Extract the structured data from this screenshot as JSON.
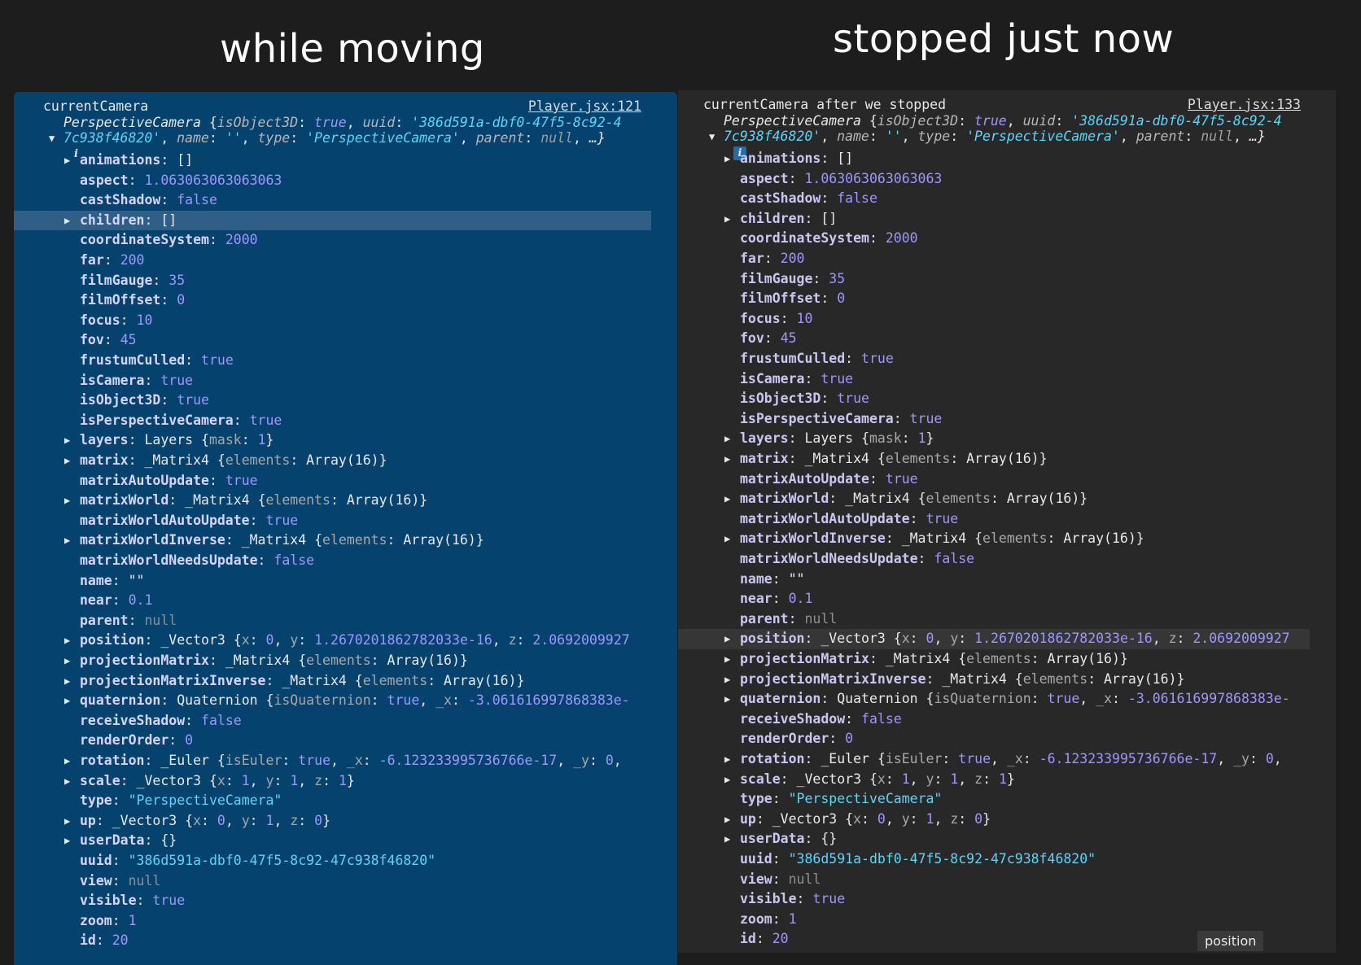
{
  "headings": {
    "left": "while moving",
    "right": "stopped just now"
  },
  "left_panel": {
    "title": "currentCamera",
    "source": "Player.jsx:121"
  },
  "right_panel": {
    "title": "currentCamera after we stopped",
    "source": "Player.jsx:133"
  },
  "object_summary": {
    "class_name": "PerspectiveCamera",
    "line1_keys": [
      "isObject3D",
      "uuid"
    ],
    "isObject3D": "true",
    "uuid_part1": "'386d591a-dbf0-47f5-8c92-4",
    "uuid_part2": "7c938f46820'",
    "line2_keys": [
      "name",
      "type",
      "parent"
    ],
    "name": "''",
    "type": "'PerspectiveCamera'",
    "parent": "null",
    "more": "…}",
    "info_icon": "i"
  },
  "properties": [
    {
      "key": "animations",
      "expandable": true,
      "parts": [
        [
          "p",
          "[]"
        ]
      ]
    },
    {
      "key": "aspect",
      "expandable": false,
      "parts": [
        [
          "n",
          "1.063063063063063"
        ]
      ]
    },
    {
      "key": "castShadow",
      "expandable": false,
      "parts": [
        [
          "b",
          "false"
        ]
      ]
    },
    {
      "key": "children",
      "expandable": true,
      "parts": [
        [
          "p",
          "[]"
        ]
      ]
    },
    {
      "key": "coordinateSystem",
      "expandable": false,
      "parts": [
        [
          "n",
          "2000"
        ]
      ]
    },
    {
      "key": "far",
      "expandable": false,
      "parts": [
        [
          "n",
          "200"
        ]
      ]
    },
    {
      "key": "filmGauge",
      "expandable": false,
      "parts": [
        [
          "n",
          "35"
        ]
      ]
    },
    {
      "key": "filmOffset",
      "expandable": false,
      "parts": [
        [
          "n",
          "0"
        ]
      ]
    },
    {
      "key": "focus",
      "expandable": false,
      "parts": [
        [
          "n",
          "10"
        ]
      ]
    },
    {
      "key": "fov",
      "expandable": false,
      "parts": [
        [
          "n",
          "45"
        ]
      ]
    },
    {
      "key": "frustumCulled",
      "expandable": false,
      "parts": [
        [
          "b",
          "true"
        ]
      ]
    },
    {
      "key": "isCamera",
      "expandable": false,
      "parts": [
        [
          "b",
          "true"
        ]
      ]
    },
    {
      "key": "isObject3D",
      "expandable": false,
      "parts": [
        [
          "b",
          "true"
        ]
      ]
    },
    {
      "key": "isPerspectiveCamera",
      "expandable": false,
      "parts": [
        [
          "b",
          "true"
        ]
      ]
    },
    {
      "key": "layers",
      "expandable": true,
      "parts": [
        [
          "ty",
          "Layers "
        ],
        [
          "p",
          "{"
        ],
        [
          "dk",
          "mask"
        ],
        [
          "p",
          ": "
        ],
        [
          "n",
          "1"
        ],
        [
          "p",
          "}"
        ]
      ]
    },
    {
      "key": "matrix",
      "expandable": true,
      "parts": [
        [
          "ty",
          "_Matrix4 "
        ],
        [
          "p",
          "{"
        ],
        [
          "dk",
          "elements"
        ],
        [
          "p",
          ": Array(16)}"
        ]
      ]
    },
    {
      "key": "matrixAutoUpdate",
      "expandable": false,
      "parts": [
        [
          "b",
          "true"
        ]
      ]
    },
    {
      "key": "matrixWorld",
      "expandable": true,
      "parts": [
        [
          "ty",
          "_Matrix4 "
        ],
        [
          "p",
          "{"
        ],
        [
          "dk",
          "elements"
        ],
        [
          "p",
          ": Array(16)}"
        ]
      ]
    },
    {
      "key": "matrixWorldAutoUpdate",
      "expandable": false,
      "parts": [
        [
          "b",
          "true"
        ]
      ]
    },
    {
      "key": "matrixWorldInverse",
      "expandable": true,
      "parts": [
        [
          "ty",
          "_Matrix4 "
        ],
        [
          "p",
          "{"
        ],
        [
          "dk",
          "elements"
        ],
        [
          "p",
          ": Array(16)}"
        ]
      ]
    },
    {
      "key": "matrixWorldNeedsUpdate",
      "expandable": false,
      "parts": [
        [
          "b",
          "false"
        ]
      ]
    },
    {
      "key": "name",
      "expandable": false,
      "parts": [
        [
          "p",
          "\"\""
        ]
      ]
    },
    {
      "key": "near",
      "expandable": false,
      "parts": [
        [
          "n",
          "0.1"
        ]
      ]
    },
    {
      "key": "parent",
      "expandable": false,
      "parts": [
        [
          "nl",
          "null"
        ]
      ]
    },
    {
      "key": "position",
      "expandable": true,
      "parts": [
        [
          "ty",
          "_Vector3 "
        ],
        [
          "p",
          "{"
        ],
        [
          "dk",
          "x"
        ],
        [
          "p",
          ": "
        ],
        [
          "n",
          "0"
        ],
        [
          "p",
          ", "
        ],
        [
          "dk",
          "y"
        ],
        [
          "p",
          ": "
        ],
        [
          "n",
          "1.2670201862782033e-16"
        ],
        [
          "p",
          ", "
        ],
        [
          "dk",
          "z"
        ],
        [
          "p",
          ": "
        ],
        [
          "n",
          "2.0692009927"
        ]
      ]
    },
    {
      "key": "projectionMatrix",
      "expandable": true,
      "parts": [
        [
          "ty",
          "_Matrix4 "
        ],
        [
          "p",
          "{"
        ],
        [
          "dk",
          "elements"
        ],
        [
          "p",
          ": Array(16)}"
        ]
      ]
    },
    {
      "key": "projectionMatrixInverse",
      "expandable": true,
      "parts": [
        [
          "ty",
          "_Matrix4 "
        ],
        [
          "p",
          "{"
        ],
        [
          "dk",
          "elements"
        ],
        [
          "p",
          ": Array(16)}"
        ]
      ]
    },
    {
      "key": "quaternion",
      "expandable": true,
      "parts": [
        [
          "ty",
          "Quaternion "
        ],
        [
          "p",
          "{"
        ],
        [
          "dk",
          "isQuaternion"
        ],
        [
          "p",
          ": "
        ],
        [
          "b",
          "true"
        ],
        [
          "p",
          ", "
        ],
        [
          "dk",
          "_x"
        ],
        [
          "p",
          ": "
        ],
        [
          "n",
          "-3.061616997868383e-"
        ]
      ]
    },
    {
      "key": "receiveShadow",
      "expandable": false,
      "parts": [
        [
          "b",
          "false"
        ]
      ]
    },
    {
      "key": "renderOrder",
      "expandable": false,
      "parts": [
        [
          "n",
          "0"
        ]
      ]
    },
    {
      "key": "rotation",
      "expandable": true,
      "parts": [
        [
          "ty",
          "_Euler "
        ],
        [
          "p",
          "{"
        ],
        [
          "dk",
          "isEuler"
        ],
        [
          "p",
          ": "
        ],
        [
          "b",
          "true"
        ],
        [
          "p",
          ", "
        ],
        [
          "dk",
          "_x"
        ],
        [
          "p",
          ": "
        ],
        [
          "n",
          "-6.123233995736766e-17"
        ],
        [
          "p",
          ", "
        ],
        [
          "dk",
          "_y"
        ],
        [
          "p",
          ": "
        ],
        [
          "n",
          "0"
        ],
        [
          "p",
          ", "
        ]
      ]
    },
    {
      "key": "scale",
      "expandable": true,
      "parts": [
        [
          "ty",
          "_Vector3 "
        ],
        [
          "p",
          "{"
        ],
        [
          "dk",
          "x"
        ],
        [
          "p",
          ": "
        ],
        [
          "n",
          "1"
        ],
        [
          "p",
          ", "
        ],
        [
          "dk",
          "y"
        ],
        [
          "p",
          ": "
        ],
        [
          "n",
          "1"
        ],
        [
          "p",
          ", "
        ],
        [
          "dk",
          "z"
        ],
        [
          "p",
          ": "
        ],
        [
          "n",
          "1"
        ],
        [
          "p",
          "}"
        ]
      ]
    },
    {
      "key": "type",
      "expandable": false,
      "parts": [
        [
          "s",
          "\"PerspectiveCamera\""
        ]
      ]
    },
    {
      "key": "up",
      "expandable": true,
      "parts": [
        [
          "ty",
          "_Vector3 "
        ],
        [
          "p",
          "{"
        ],
        [
          "dk",
          "x"
        ],
        [
          "p",
          ": "
        ],
        [
          "n",
          "0"
        ],
        [
          "p",
          ", "
        ],
        [
          "dk",
          "y"
        ],
        [
          "p",
          ": "
        ],
        [
          "n",
          "1"
        ],
        [
          "p",
          ", "
        ],
        [
          "dk",
          "z"
        ],
        [
          "p",
          ": "
        ],
        [
          "n",
          "0"
        ],
        [
          "p",
          "}"
        ]
      ]
    },
    {
      "key": "userData",
      "expandable": true,
      "parts": [
        [
          "p",
          "{}"
        ]
      ]
    },
    {
      "key": "uuid",
      "expandable": false,
      "parts": [
        [
          "s",
          "\"386d591a-dbf0-47f5-8c92-47c938f46820\""
        ]
      ]
    },
    {
      "key": "view",
      "expandable": false,
      "parts": [
        [
          "nl",
          "null"
        ]
      ]
    },
    {
      "key": "visible",
      "expandable": false,
      "parts": [
        [
          "b",
          "true"
        ]
      ]
    },
    {
      "key": "zoom",
      "expandable": false,
      "parts": [
        [
          "n",
          "1"
        ]
      ]
    },
    {
      "key": "id",
      "expandable": false,
      "parts": [
        [
          "n",
          "20"
        ]
      ]
    }
  ],
  "left_highlight_key": "children",
  "right_highlight_key": "position",
  "tooltip": "position"
}
